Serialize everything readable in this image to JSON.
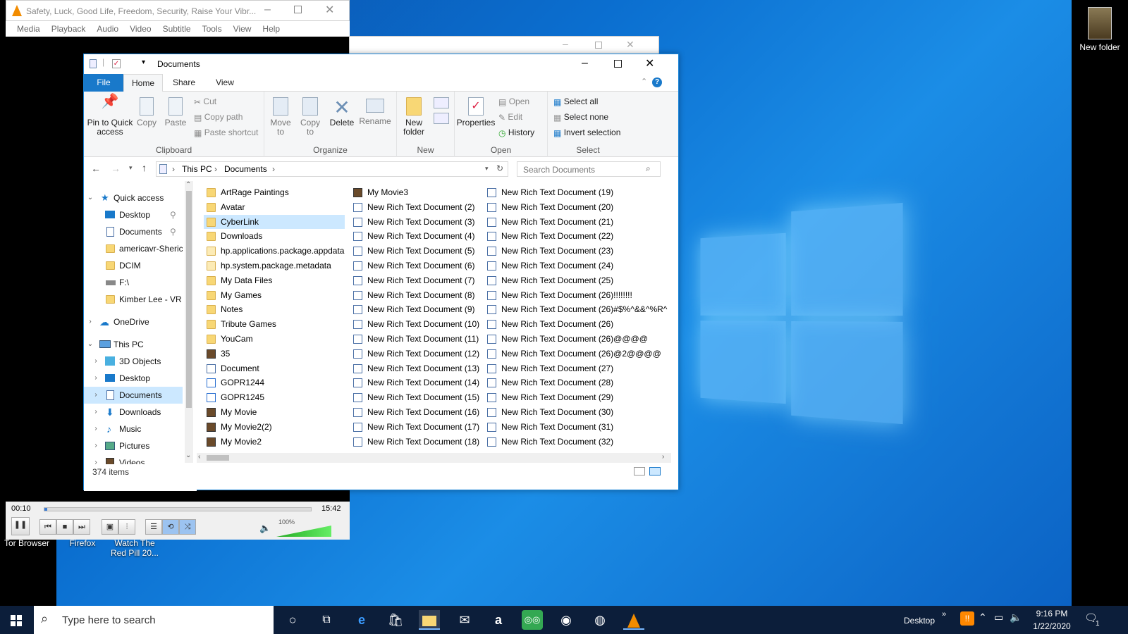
{
  "desktop": {
    "icons": [
      {
        "label": "New folder"
      },
      {
        "label": "Tor Browser"
      },
      {
        "label": "Firefox"
      },
      {
        "label": "Watch The Red Pill 20..."
      }
    ]
  },
  "vlc": {
    "title": "Safety, Luck, Good Life, Freedom, Security, Raise Your Vibr...",
    "menu": [
      "Media",
      "Playback",
      "Audio",
      "Video",
      "Subtitle",
      "Tools",
      "View",
      "Help"
    ],
    "time_elapsed": "00:10",
    "time_total": "15:42",
    "progress": 0.011,
    "volume_label": "100%",
    "volume": 1.0
  },
  "explorer": {
    "title": "Documents",
    "tabs": [
      "File",
      "Home",
      "Share",
      "View"
    ],
    "active_tab": "Home",
    "ribbon": {
      "clipboard": {
        "label": "Clipboard",
        "pin": "Pin to Quick access",
        "copy": "Copy",
        "paste": "Paste",
        "cut": "Cut",
        "copy_path": "Copy path",
        "paste_shortcut": "Paste shortcut"
      },
      "organize": {
        "label": "Organize",
        "move_to": "Move to",
        "copy_to": "Copy to",
        "delete": "Delete",
        "rename": "Rename"
      },
      "new": {
        "label": "New",
        "new_folder": "New folder"
      },
      "open": {
        "label": "Open",
        "properties": "Properties",
        "open": "Open",
        "edit": "Edit",
        "history": "History"
      },
      "select": {
        "label": "Select",
        "select_all": "Select all",
        "select_none": "Select none",
        "invert": "Invert selection"
      }
    },
    "address": {
      "crumbs": [
        "This PC",
        "Documents"
      ],
      "search_placeholder": "Search Documents"
    },
    "nav": {
      "quick_access": "Quick access",
      "quick_items": [
        "Desktop",
        "Documents",
        "americavr-Sheric",
        "DCIM",
        "F:\\",
        "Kimber Lee - VR"
      ],
      "onedrive": "OneDrive",
      "this_pc": "This PC",
      "pc_items": [
        "3D Objects",
        "Desktop",
        "Documents",
        "Downloads",
        "Music",
        "Pictures",
        "Videos"
      ]
    },
    "status": "374 items",
    "files_col1": [
      {
        "name": "ArtRage Paintings",
        "type": "folder"
      },
      {
        "name": "Avatar",
        "type": "folder"
      },
      {
        "name": "CyberLink",
        "type": "folder"
      },
      {
        "name": "Downloads",
        "type": "folder"
      },
      {
        "name": "hp.applications.package.appdata",
        "type": "folder-light"
      },
      {
        "name": "hp.system.package.metadata",
        "type": "folder-light"
      },
      {
        "name": "My Data Files",
        "type": "folder"
      },
      {
        "name": "My Games",
        "type": "folder"
      },
      {
        "name": "Notes",
        "type": "folder"
      },
      {
        "name": "Tribute Games",
        "type": "folder"
      },
      {
        "name": "YouCam",
        "type": "folder"
      },
      {
        "name": "35",
        "type": "movie"
      },
      {
        "name": "Document",
        "type": "doc"
      },
      {
        "name": "GOPR1244",
        "type": "img"
      },
      {
        "name": "GOPR1245",
        "type": "img"
      },
      {
        "name": "My Movie",
        "type": "movie"
      },
      {
        "name": "My Movie2(2)",
        "type": "movie"
      },
      {
        "name": "My Movie2",
        "type": "movie"
      }
    ],
    "files_col2": [
      "My Movie3",
      "New Rich Text Document (2)",
      "New Rich Text Document (3)",
      "New Rich Text Document (4)",
      "New Rich Text Document (5)",
      "New Rich Text Document (6)",
      "New Rich Text Document (7)",
      "New Rich Text Document (8)",
      "New Rich Text Document (9)",
      "New Rich Text Document (10)",
      "New Rich Text Document (11)",
      "New Rich Text Document (12)",
      "New Rich Text Document (13)",
      "New Rich Text Document (14)",
      "New Rich Text Document (15)",
      "New Rich Text Document (16)",
      "New Rich Text Document (17)",
      "New Rich Text Document (18)"
    ],
    "files_col3": [
      "New Rich Text Document (19)",
      "New Rich Text Document (20)",
      "New Rich Text Document (21)",
      "New Rich Text Document (22)",
      "New Rich Text Document (23)",
      "New Rich Text Document (24)",
      "New Rich Text Document (25)",
      "New Rich Text Document (26)!!!!!!!!",
      "New Rich Text Document (26)#$%^&&^%R^",
      "New Rich Text Document (26)",
      "New Rich Text Document (26)@@@@",
      "New Rich Text Document (26)@2@@@@",
      "New Rich Text Document (27)",
      "New Rich Text Document (28)",
      "New Rich Text Document (29)",
      "New Rich Text Document (30)",
      "New Rich Text Document (31)",
      "New Rich Text Document (32)"
    ]
  },
  "taskbar": {
    "search_placeholder": "Type here to search",
    "desktop_label": "Desktop",
    "time": "9:16 PM",
    "date": "1/22/2020",
    "notification_count": "1"
  }
}
